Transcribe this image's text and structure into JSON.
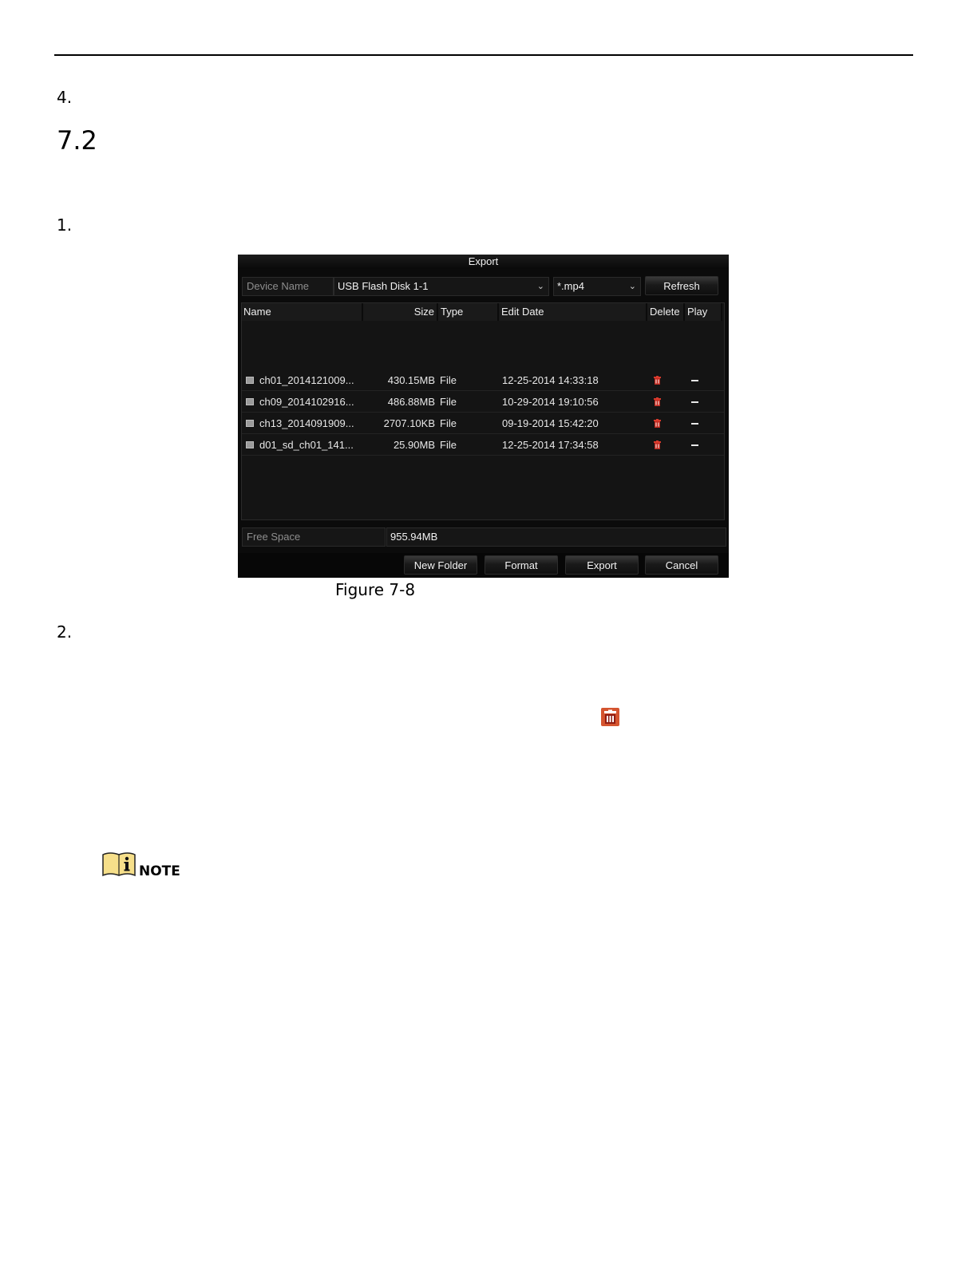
{
  "document": {
    "step_4": "4.",
    "section_number": "7.2",
    "step_1": "1.",
    "step_2": "2.",
    "figure_caption": "Figure 7-8",
    "note_label": "NOTE"
  },
  "export_dialog": {
    "title": "Export",
    "device_name_label": "Device Name",
    "device_name_value": "USB Flash Disk 1-1",
    "file_type_value": "*.mp4",
    "refresh_label": "Refresh",
    "columns": {
      "name": "Name",
      "size": "Size",
      "type": "Type",
      "edit_date": "Edit Date",
      "delete": "Delete",
      "play": "Play"
    },
    "files": [
      {
        "name": "ch01_2014121009...",
        "size": "430.15MB",
        "type": "File",
        "edit_date": "12-25-2014 14:33:18"
      },
      {
        "name": "ch09_2014102916...",
        "size": "486.88MB",
        "type": "File",
        "edit_date": "10-29-2014 19:10:56"
      },
      {
        "name": "ch13_2014091909...",
        "size": "2707.10KB",
        "type": "File",
        "edit_date": "09-19-2014 15:42:20"
      },
      {
        "name": "d01_sd_ch01_141...",
        "size": "25.90MB",
        "type": "File",
        "edit_date": "12-25-2014 17:34:58"
      }
    ],
    "free_space_label": "Free Space",
    "free_space_value": "955.94MB",
    "buttons": {
      "new_folder": "New Folder",
      "format": "Format",
      "export": "Export",
      "cancel": "Cancel"
    }
  },
  "icons": {
    "file_row_icon": "file-icon",
    "delete_icon": "trash-icon",
    "play_icon": "dash-icon",
    "note_icon": "info-book-icon"
  },
  "colors": {
    "dialog_background": "#0b0b0b",
    "trash_red": "#c0281e",
    "note_yellow": "#f6df8a"
  }
}
